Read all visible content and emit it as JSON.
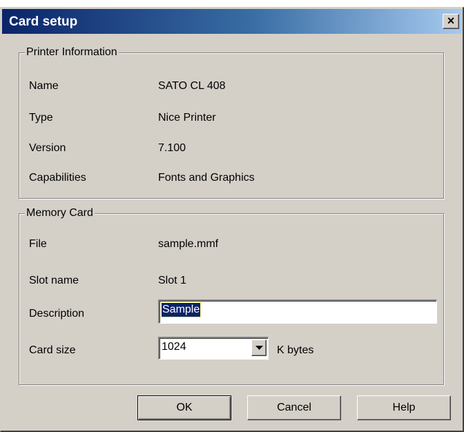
{
  "window": {
    "title": "Card setup",
    "close_glyph": "×"
  },
  "printer_info": {
    "legend": "Printer Information",
    "rows": [
      {
        "label": "Name",
        "value": "SATO CL 408"
      },
      {
        "label": "Type",
        "value": "Nice Printer"
      },
      {
        "label": "Version",
        "value": "7.100"
      },
      {
        "label": "Capabilities",
        "value": "Fonts and Graphics"
      }
    ]
  },
  "memory_card": {
    "legend": "Memory Card",
    "file_label": "File",
    "file_value": "sample.mmf",
    "slot_label": "Slot name",
    "slot_value": "Slot 1",
    "description_label": "Description",
    "description_value": "Sample",
    "card_size_label": "Card size",
    "card_size_value": "1024",
    "card_size_unit": "K bytes"
  },
  "buttons": {
    "ok": "OK",
    "cancel": "Cancel",
    "help": "Help"
  },
  "colors": {
    "titlebar_start": "#0a246a",
    "titlebar_end": "#a6caf0",
    "face": "#d4d0c8",
    "selection": "#0a246a"
  }
}
